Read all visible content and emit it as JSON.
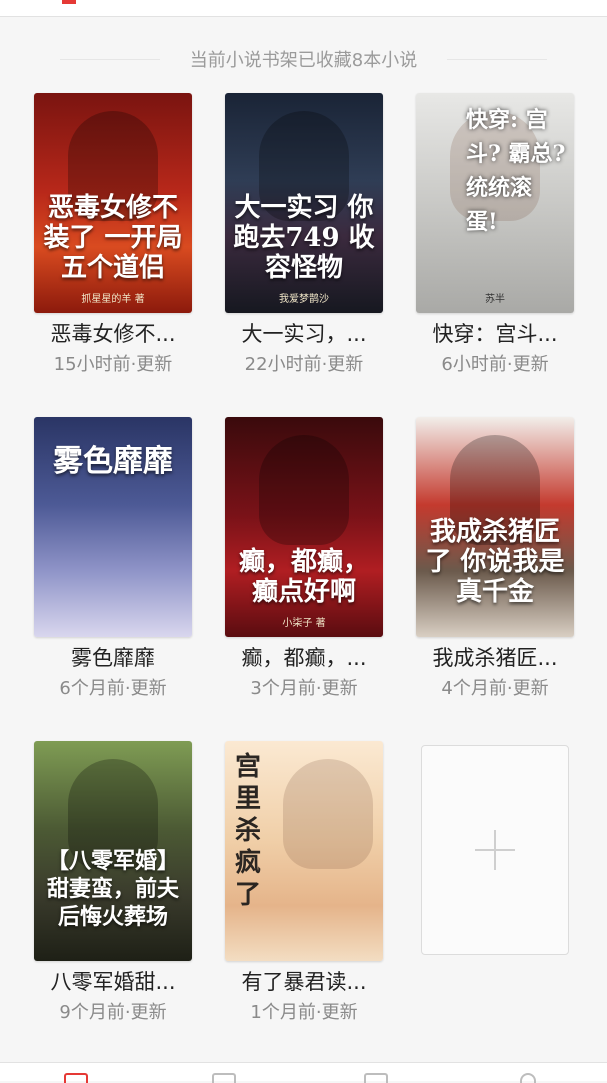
{
  "shelf": {
    "summary": "当前小说书架已收藏8本小说"
  },
  "books": [
    {
      "cover_title": "恶毒女修不装了 一开局 五个道侣",
      "cover_author": "抓星星的羊 著",
      "name": "恶毒女修不...",
      "updated": "15小时前·更新"
    },
    {
      "cover_title": "大一实习 你跑去749 收容怪物",
      "cover_author": "我爱梦鹊沙",
      "name": "大一实习，...",
      "updated": "22小时前·更新"
    },
    {
      "cover_title": "快穿: 宫斗? 霸总? 统统滚 蛋!",
      "cover_author": "苏半",
      "name": "快穿：宫斗...",
      "updated": "6小时前·更新"
    },
    {
      "cover_title": "雾色靡靡",
      "cover_author": "",
      "name": "雾色靡靡",
      "updated": "6个月前·更新"
    },
    {
      "cover_title": "癫，都癫，癫点好啊",
      "cover_author": "小柒子 著",
      "name": "癫，都癫，...",
      "updated": "3个月前·更新"
    },
    {
      "cover_title": "我成杀猪匠了 你说我是 真千金",
      "cover_author": "",
      "name": "我成杀猪匠...",
      "updated": "4个月前·更新"
    },
    {
      "cover_title": "【八零军婚】 甜妻蛮，前夫 后悔火葬场",
      "cover_author": "",
      "name": "八零军婚甜...",
      "updated": "9个月前·更新"
    },
    {
      "cover_title": "宫里杀疯了",
      "cover_author": "",
      "name": "有了暴君读...",
      "updated": "1个月前·更新"
    }
  ],
  "add_book": {
    "icon": "plus-icon"
  },
  "bottom_nav": {
    "icons": [
      "home-icon",
      "book-icon",
      "category-icon",
      "profile-icon"
    ],
    "active_color": "#e53935"
  },
  "colors": {
    "accent": "#e53935",
    "background": "#f6f6f6",
    "muted_text": "#8a8a8a"
  }
}
